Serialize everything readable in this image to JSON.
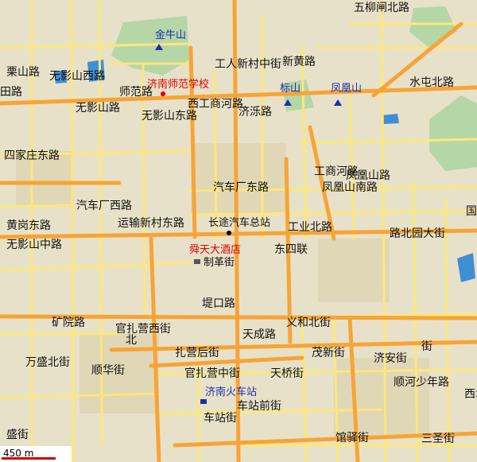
{
  "map": {
    "colors": {
      "land": "#e8e1c9",
      "block": "#d9cfa8",
      "park": "#b5d6a7",
      "water": "#3f8fd4",
      "major_road": "#f7a436",
      "minor_road": "#fbe87a",
      "poi_red": "#e00000",
      "poi_blue": "#1a2fb0"
    },
    "labels": {
      "liulinbei": "五柳闸北路",
      "susan": "栗山路",
      "tianlu": "田路",
      "jinniushan": "金牛山",
      "jinan_shifan": "济南师范学校",
      "shifanlu": "师范路",
      "xinhuang": "新黄路",
      "biaoshan": "标山",
      "fenghuangshan": "凤凰山",
      "shuitun": "水屯北路",
      "wuyingshan_xi": "无影山西路",
      "wuyingshan_dong": "无影山东路",
      "wuying_bei": "无影山路",
      "gongren": "工人新村中街",
      "xigong": "西工商河路",
      "jiluo": "济泺路",
      "sijiazhuang": "四家庄东路",
      "qichechang_lu": "汽车厂东路",
      "qichechang_xi": "汽车厂西路",
      "gongshang_he": "工商河路",
      "fenghuang_nan": "凤凰山南路",
      "fenghuang_lu": "凤凰山路",
      "huanggang": "黄岗东路",
      "wuyingshan_zhong": "无影山中路",
      "yunshu": "运输新村东路",
      "changtu": "长途汽车总站",
      "gongye": "工业北路",
      "beiyuan": "路北园大街",
      "shuntian": "舜天大酒店",
      "zhige": "制革街",
      "dongsi": "东四联",
      "kuangyuan": "矿院路",
      "guanzha": "官扎营西街",
      "zhahou": "扎营后街",
      "tikou": "堤口路",
      "yihe": "义和北街",
      "tiancheng": "天成路",
      "wansheng": "万盛北街",
      "shunhua": "顺华街",
      "guanzhaying_zhong": "官扎营中街",
      "maoxin": "茂新街",
      "jian": "济安街",
      "shaonian": "顺河少年路",
      "tianqiao": "天桥街",
      "jinan_huochezhan": "济南火车站",
      "chezhan_qian": "车站前街",
      "chezhan_jie": "车站街",
      "guanyi": "馆驿街",
      "sansheng": "三圣街",
      "xicheng": "西城根街",
      "shengchu": "盛街",
      "guo": "国",
      "shengnan": "北",
      "hexue": "街"
    },
    "scale": "450 m"
  }
}
